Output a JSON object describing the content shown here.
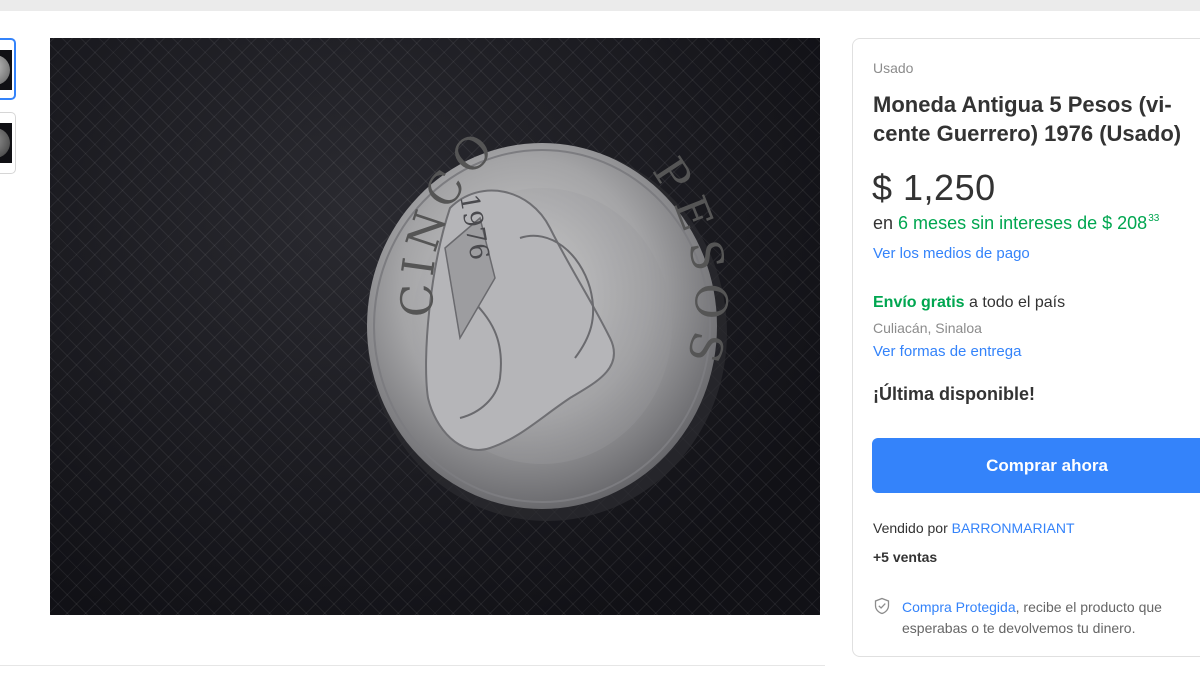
{
  "thumbnails": [
    {
      "alt": "coin-front-thumbnail",
      "active": true
    },
    {
      "alt": "coin-back-thumbnail",
      "active": false
    }
  ],
  "photo": {
    "coin_top_text": "CINCO",
    "coin_right_text": "PESOS",
    "coin_year": "1976"
  },
  "product": {
    "condition": "Usado",
    "title_line1": "Moneda Antigua 5 Pesos (vi-",
    "title_line2": "cente Guerrero) 1976 (Usado)",
    "price": "$ 1,250",
    "installments_prefix": "en",
    "installments_green": "6 meses sin intereses de $ 208",
    "installments_cents": "33",
    "payment_link": "Ver los medios de pago",
    "shipping_green": "Envío gratis",
    "shipping_rest": "a todo el país",
    "location": "Culiacán, Sinaloa",
    "delivery_link": "Ver formas de entrega",
    "stock": "¡Última disponible!",
    "buy_button": "Comprar ahora",
    "seller_prefix": "Vendido por",
    "seller_name": "BARRONMARIANT",
    "sales": "+5 ventas",
    "protected_link": "Compra Protegida",
    "protected_text_1": ", recibe el producto que",
    "protected_text_2": "esperabas o te devolvemos tu dinero."
  },
  "colors": {
    "accent": "#3483fa",
    "green": "#00a650",
    "muted": "#8c8c8c"
  },
  "icons": {
    "protect": "shield-check-icon"
  }
}
